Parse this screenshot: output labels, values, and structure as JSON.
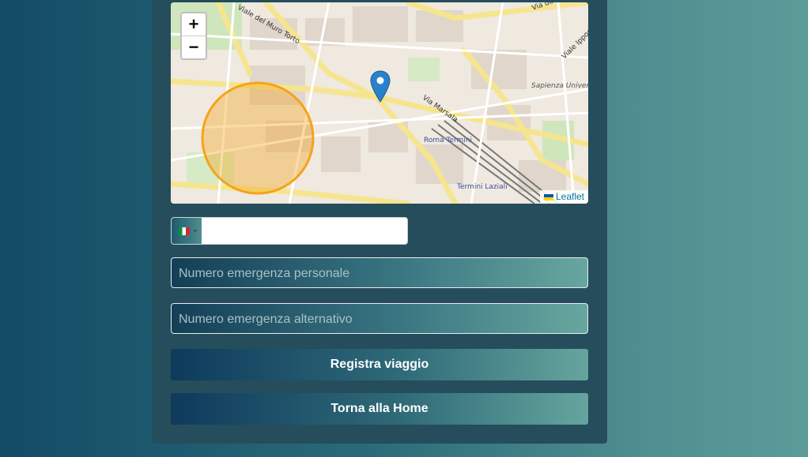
{
  "map": {
    "zoom_in": "+",
    "zoom_out": "−",
    "attribution": "Leaflet",
    "labels": {
      "via_marsala": "Via Marsala",
      "roma_termini": "Roma Termini",
      "termini_laziali": "Termini Laziali",
      "sapienza": "Sapienza Università di Roma",
      "muro_torto": "Viale del Muro Torto",
      "viale_ippocrate": "Viale Ippocrate",
      "via_dei": "Via dei"
    },
    "colors": {
      "circle": "#f5a31a",
      "marker": "#2a81cb"
    }
  },
  "form": {
    "phone_value": "",
    "emergency_personal_placeholder": "Numero emergenza personale",
    "emergency_alt_placeholder": "Numero emergenza alternativo"
  },
  "buttons": {
    "register": "Registra viaggio",
    "home": "Torna alla Home"
  }
}
